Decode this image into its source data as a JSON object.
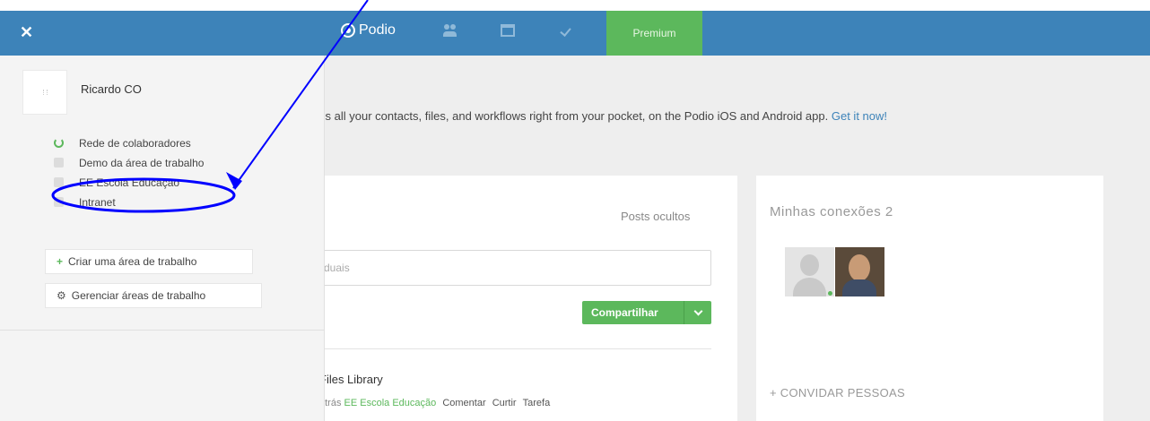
{
  "topbar": {
    "close_icon": "close-icon",
    "logo_text": "Podio",
    "premium_label": "Premium",
    "color": "#3d83b9"
  },
  "sidebar": {
    "user_name": "Ricardo CO",
    "workspaces": [
      {
        "label": "Rede de colaboradores",
        "icon": "recycle-icon"
      },
      {
        "label": "Demo da área de trabalho",
        "icon": "workspace-icon"
      },
      {
        "label": "EE Escola Educação",
        "icon": "workspace-icon"
      },
      {
        "label": "Intranet",
        "icon": "workspace-icon"
      }
    ],
    "create_label": "Criar uma área de trabalho",
    "manage_label": "Gerenciar áreas de trabalho"
  },
  "promo": {
    "text": "ss all your contacts, files, and workflows right from your pocket, on the Podio iOS and Android app.",
    "link": "Get it now!"
  },
  "feed": {
    "hidden_posts": "Posts ocultos",
    "input_placeholder": "duais",
    "share_label": "Compartilhar",
    "post_title": "Files Library",
    "post_time": "atrás",
    "post_workspace": "EE Escola Educação",
    "actions": [
      "Comentar",
      "Curtir",
      "Tarefa"
    ]
  },
  "connections": {
    "title": "Minhas conexões",
    "count": "2",
    "invite_label": "+ CONVIDAR PESSOAS"
  },
  "colors": {
    "brand_blue": "#3d83b9",
    "green": "#5cb85c",
    "annotation_blue": "#0000ff"
  }
}
